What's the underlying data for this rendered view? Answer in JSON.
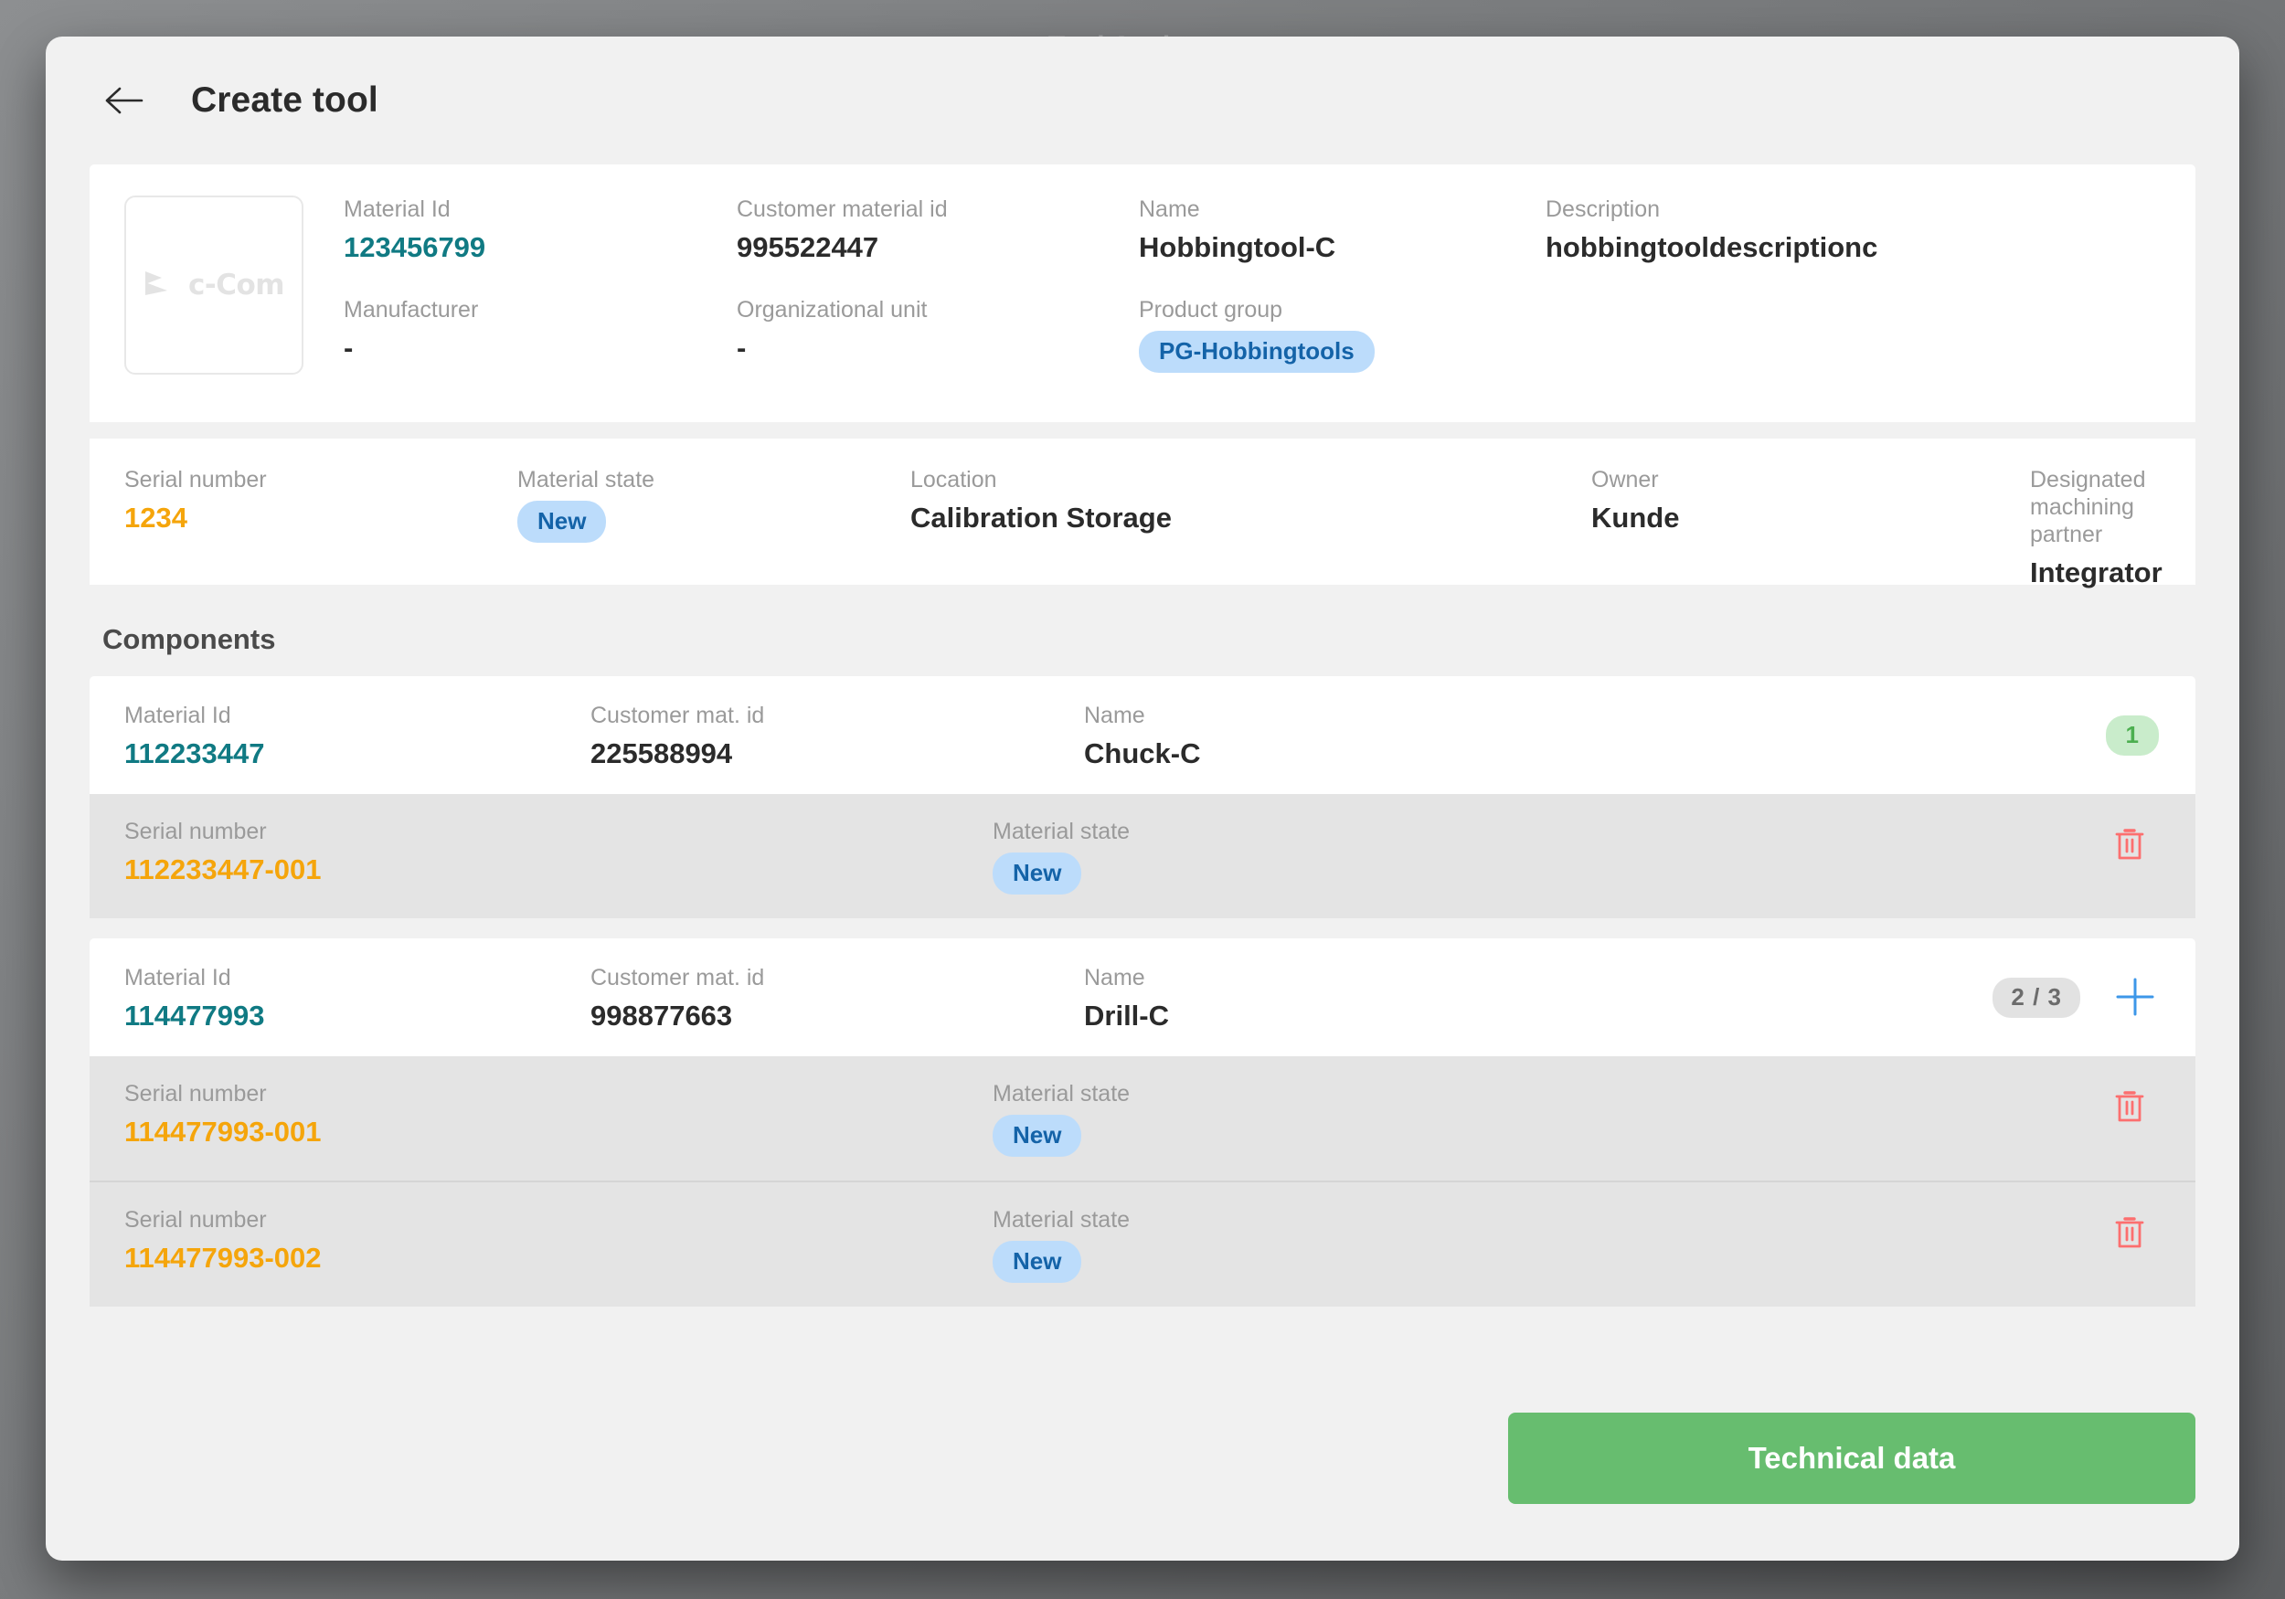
{
  "background": {
    "watermark_title": "Tool Assistant"
  },
  "header": {
    "back_icon": "arrow-left-icon",
    "title": "Create tool"
  },
  "colors": {
    "accent_teal": "#107a83",
    "accent_amber": "#f5a50b",
    "badge_blue_bg": "#bcdcfb",
    "badge_blue_text": "#1463a8",
    "badge_green_bg": "#c9eccb",
    "badge_green_text": "#4caf50",
    "badge_gray_bg": "#e2e2e2",
    "badge_gray_text": "#6c6c6c",
    "primary_green": "#67bd6f",
    "delete_red": "#fc6f6f",
    "add_blue": "#3d97e8"
  },
  "tool": {
    "logo_text": "c-Com",
    "fields": {
      "material_id_label": "Material Id",
      "material_id_value": "123456799",
      "customer_material_id_label": "Customer material id",
      "customer_material_id_value": "995522447",
      "name_label": "Name",
      "name_value": "Hobbingtool-C",
      "description_label": "Description",
      "description_value": "hobbingtooldescriptionc",
      "manufacturer_label": "Manufacturer",
      "manufacturer_value": "-",
      "organizational_unit_label": "Organizational unit",
      "organizational_unit_value": "-",
      "product_group_label": "Product group",
      "product_group_value": "PG-Hobbingtools"
    },
    "serial_strip": {
      "serial_number_label": "Serial number",
      "serial_number_value": "1234",
      "material_state_label": "Material state",
      "material_state_value": "New",
      "location_label": "Location",
      "location_value": "Calibration Storage",
      "owner_label": "Owner",
      "owner_value": "Kunde",
      "partner_label": "Designated machining partner",
      "partner_value": "Integrator"
    }
  },
  "components": {
    "section_title": "Components",
    "labels": {
      "material_id": "Material Id",
      "customer_mat_id": "Customer mat. id",
      "name": "Name",
      "serial_number": "Serial number",
      "material_state": "Material state"
    },
    "groups": [
      {
        "material_id": "112233447",
        "customer_mat_id": "225588994",
        "name": "Chuck-C",
        "count_badge": "1",
        "has_add_button": false,
        "serials": [
          {
            "serial_number": "112233447-001",
            "material_state": "New"
          }
        ]
      },
      {
        "material_id": "114477993",
        "customer_mat_id": "998877663",
        "name": "Drill-C",
        "count_badge": "2 / 3",
        "has_add_button": true,
        "serials": [
          {
            "serial_number": "114477993-001",
            "material_state": "New"
          },
          {
            "serial_number": "114477993-002",
            "material_state": "New"
          }
        ]
      }
    ]
  },
  "footer": {
    "primary_button_label": "Technical data"
  }
}
